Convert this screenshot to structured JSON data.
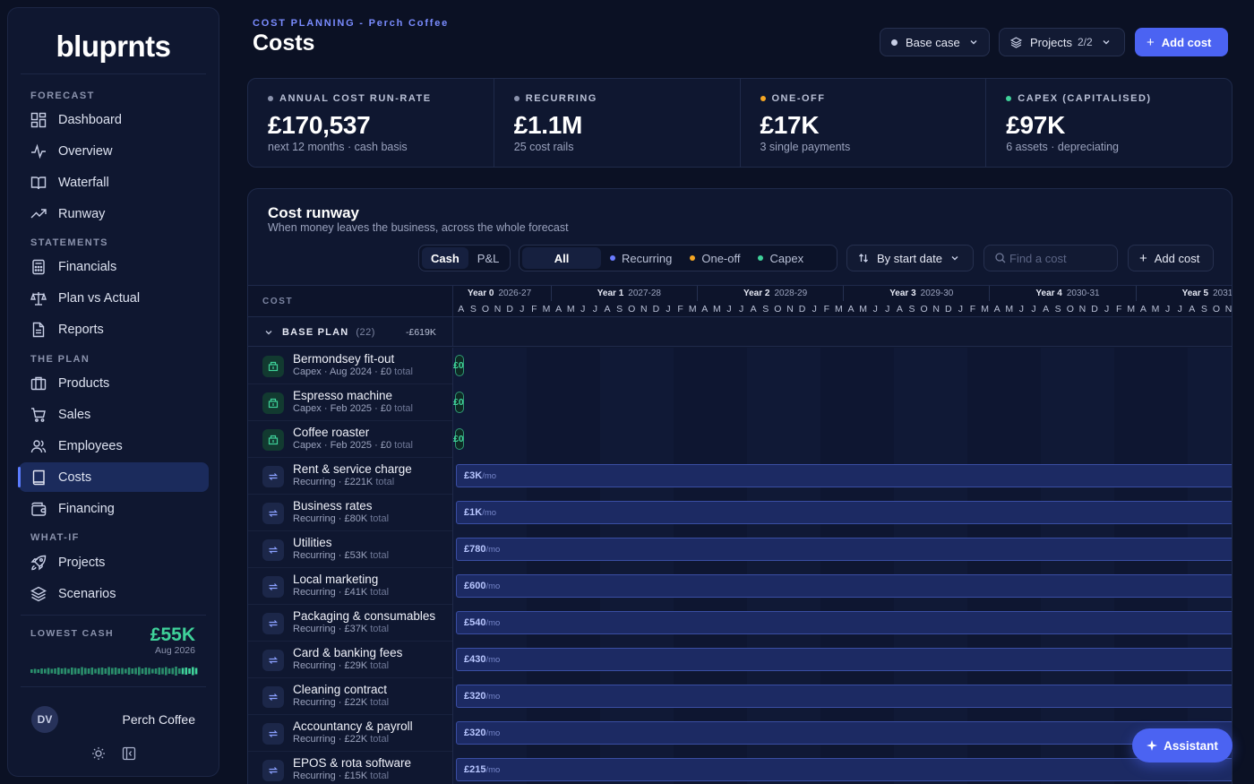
{
  "brand": {
    "logo": "bluprnts"
  },
  "sidebar": {
    "sections": [
      {
        "label": "FORECAST",
        "items": [
          {
            "label": "Dashboard",
            "icon": "dashboard-icon"
          },
          {
            "label": "Overview",
            "icon": "activity-icon"
          },
          {
            "label": "Waterfall",
            "icon": "book-open-icon"
          },
          {
            "label": "Runway",
            "icon": "trending-up-icon"
          }
        ]
      },
      {
        "label": "STATEMENTS",
        "items": [
          {
            "label": "Financials",
            "icon": "calculator-icon"
          },
          {
            "label": "Plan vs Actual",
            "icon": "scale-icon"
          },
          {
            "label": "Reports",
            "icon": "document-icon"
          }
        ]
      },
      {
        "label": "THE PLAN",
        "items": [
          {
            "label": "Products",
            "icon": "package-icon"
          },
          {
            "label": "Sales",
            "icon": "cart-icon"
          },
          {
            "label": "Employees",
            "icon": "users-icon"
          },
          {
            "label": "Costs",
            "icon": "receipt-icon",
            "active": true
          },
          {
            "label": "Financing",
            "icon": "wallet-icon"
          }
        ]
      },
      {
        "label": "WHAT-IF",
        "items": [
          {
            "label": "Projects",
            "icon": "rocket-icon"
          },
          {
            "label": "Scenarios",
            "icon": "layers-icon"
          }
        ]
      }
    ],
    "lowest_cash": {
      "label": "LOWEST CASH",
      "value": "£55K",
      "date": "Aug 2026"
    },
    "user": {
      "initials": "DV",
      "org": "Perch Coffee"
    }
  },
  "header": {
    "eyebrow": "COST PLANNING - Perch Coffee",
    "title": "Costs",
    "scenario": "Base case",
    "projects_label": "Projects",
    "projects_count": "2/2",
    "add_cost": "Add cost"
  },
  "kpis": [
    {
      "label": "ANNUAL COST RUN-RATE",
      "value": "£170,537",
      "sub": "next 12 months · cash basis",
      "color": "#8b93ad"
    },
    {
      "label": "RECURRING",
      "value": "£1.1M",
      "sub": "25 cost rails",
      "color": "#8b93ad"
    },
    {
      "label": "ONE-OFF",
      "value": "£17K",
      "sub": "3 single payments",
      "color": "#f5a623"
    },
    {
      "label": "CAPEX (CAPITALISED)",
      "value": "£97K",
      "sub": "6 assets · depreciating",
      "color": "#3fd29a"
    }
  ],
  "panel": {
    "title": "Cost runway",
    "subtitle": "When money leaves the business, across the whole forecast",
    "basis": {
      "cash": "Cash",
      "pl": "P&L",
      "selected": "Cash"
    },
    "filters": [
      {
        "label": "All",
        "selected": true
      },
      {
        "label": "Recurring",
        "color": "#6b7cff"
      },
      {
        "label": "One-off",
        "color": "#f5a623"
      },
      {
        "label": "Capex",
        "color": "#3fd29a"
      }
    ],
    "sort_label": "By start date",
    "search_placeholder": "Find a cost",
    "add_cost": "Add cost"
  },
  "timeline": {
    "cost_column": "COST",
    "years": [
      {
        "label": "Year 0",
        "range": "2026-27"
      },
      {
        "label": "Year 1",
        "range": "2027-28"
      },
      {
        "label": "Year 2",
        "range": "2028-29"
      },
      {
        "label": "Year 3",
        "range": "2029-30"
      },
      {
        "label": "Year 4",
        "range": "2030-31"
      },
      {
        "label": "Year 5",
        "range": "2031-"
      }
    ],
    "months": [
      "A",
      "S",
      "O",
      "N",
      "D",
      "J",
      "F",
      "M",
      "A",
      "M",
      "J",
      "J",
      "A",
      "S",
      "O",
      "N",
      "D",
      "J",
      "F",
      "M",
      "A",
      "M",
      "J",
      "J",
      "A",
      "S",
      "O",
      "N",
      "D",
      "J",
      "F",
      "M",
      "A",
      "M",
      "J",
      "J",
      "A",
      "S",
      "O",
      "N",
      "D",
      "J",
      "F",
      "M",
      "A",
      "M",
      "J",
      "J",
      "A",
      "S",
      "O",
      "N",
      "D",
      "J",
      "F",
      "M",
      "A",
      "M",
      "J",
      "J",
      "A",
      "S",
      "O",
      "N"
    ]
  },
  "group": {
    "name": "BASE PLAN",
    "count": "(22)",
    "total": "-£619K"
  },
  "costs": [
    {
      "name": "Bermondsey fit-out",
      "type": "Capex",
      "meta": "Capex · Aug 2024 · £0",
      "total": "total",
      "bar": "£0",
      "kind": "capex"
    },
    {
      "name": "Espresso machine",
      "type": "Capex",
      "meta": "Capex · Feb 2025 · £0",
      "total": "total",
      "bar": "£0",
      "kind": "capex"
    },
    {
      "name": "Coffee roaster",
      "type": "Capex",
      "meta": "Capex · Feb 2025 · £0",
      "total": "total",
      "bar": "£0",
      "kind": "capex"
    },
    {
      "name": "Rent & service charge",
      "type": "Recurring",
      "meta": "Recurring · £221K",
      "total": "total",
      "bar": "£3K",
      "unit": "/mo",
      "kind": "recurring"
    },
    {
      "name": "Business rates",
      "type": "Recurring",
      "meta": "Recurring · £80K",
      "total": "total",
      "bar": "£1K",
      "unit": "/mo",
      "kind": "recurring"
    },
    {
      "name": "Utilities",
      "type": "Recurring",
      "meta": "Recurring · £53K",
      "total": "total",
      "bar": "£780",
      "unit": "/mo",
      "kind": "recurring"
    },
    {
      "name": "Local marketing",
      "type": "Recurring",
      "meta": "Recurring · £41K",
      "total": "total",
      "bar": "£600",
      "unit": "/mo",
      "kind": "recurring"
    },
    {
      "name": "Packaging & consumables",
      "type": "Recurring",
      "meta": "Recurring · £37K",
      "total": "total",
      "bar": "£540",
      "unit": "/mo",
      "kind": "recurring"
    },
    {
      "name": "Card & banking fees",
      "type": "Recurring",
      "meta": "Recurring · £29K",
      "total": "total",
      "bar": "£430",
      "unit": "/mo",
      "kind": "recurring"
    },
    {
      "name": "Cleaning contract",
      "type": "Recurring",
      "meta": "Recurring · £22K",
      "total": "total",
      "bar": "£320",
      "unit": "/mo",
      "kind": "recurring"
    },
    {
      "name": "Accountancy & payroll",
      "type": "Recurring",
      "meta": "Recurring · £22K",
      "total": "total",
      "bar": "£320",
      "unit": "/mo",
      "kind": "recurring"
    },
    {
      "name": "EPOS & rota software",
      "type": "Recurring",
      "meta": "Recurring · £15K",
      "total": "total",
      "bar": "£215",
      "unit": "/mo",
      "kind": "recurring"
    }
  ],
  "assistant": {
    "label": "Assistant"
  }
}
